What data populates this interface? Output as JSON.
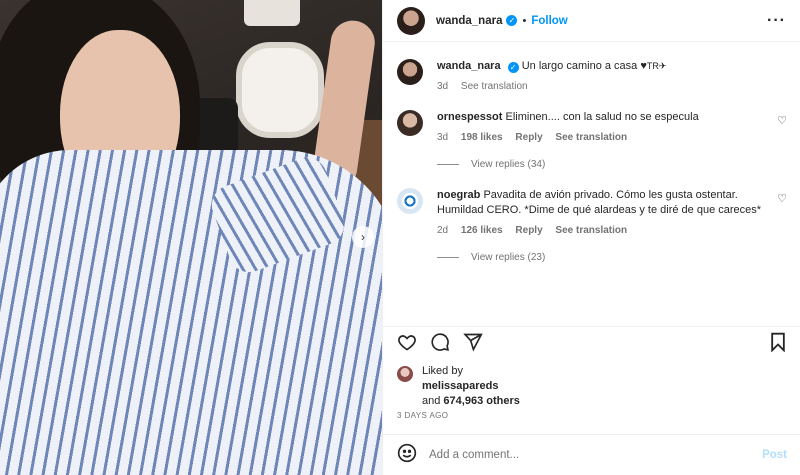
{
  "post": {
    "username": "wanda_nara",
    "verified_icon": "verified-badge",
    "follow_label": "Follow",
    "more_icon": "more-options-icon"
  },
  "caption": {
    "username": "wanda_nara",
    "text": "Un largo camino a casa ♥",
    "emoji": "TR✈",
    "time": "3d",
    "see_translation": "See translation"
  },
  "comments": [
    {
      "username": "ornespessot",
      "text": "Eliminen.... con la salud no se especula",
      "time": "3d",
      "likes": "198 likes",
      "reply": "Reply",
      "see_translation": "See translation",
      "view_replies": "View replies (34)"
    },
    {
      "username": "noegrab",
      "text": "Pavadita de avión privado. Cómo les gusta ostentar. Humildad CERO. *Dime de qué alardeas y te diré de que careces*",
      "time": "2d",
      "likes": "126 likes",
      "reply": "Reply",
      "see_translation": "See translation",
      "view_replies": "View replies (23)"
    }
  ],
  "actions": {
    "like_icon": "heart-icon",
    "comment_icon": "comment-icon",
    "share_icon": "share-icon",
    "save_icon": "bookmark-icon"
  },
  "likes": {
    "liked_by": "Liked by",
    "user": "melissapareds",
    "and": "and",
    "others": "674,963 others"
  },
  "date": "3 DAYS AGO",
  "add_comment": {
    "placeholder": "Add a comment...",
    "post_label": "Post"
  },
  "colors": {
    "accent": "#0095f6",
    "post_disabled": "#b2dffc",
    "muted": "#737373"
  }
}
